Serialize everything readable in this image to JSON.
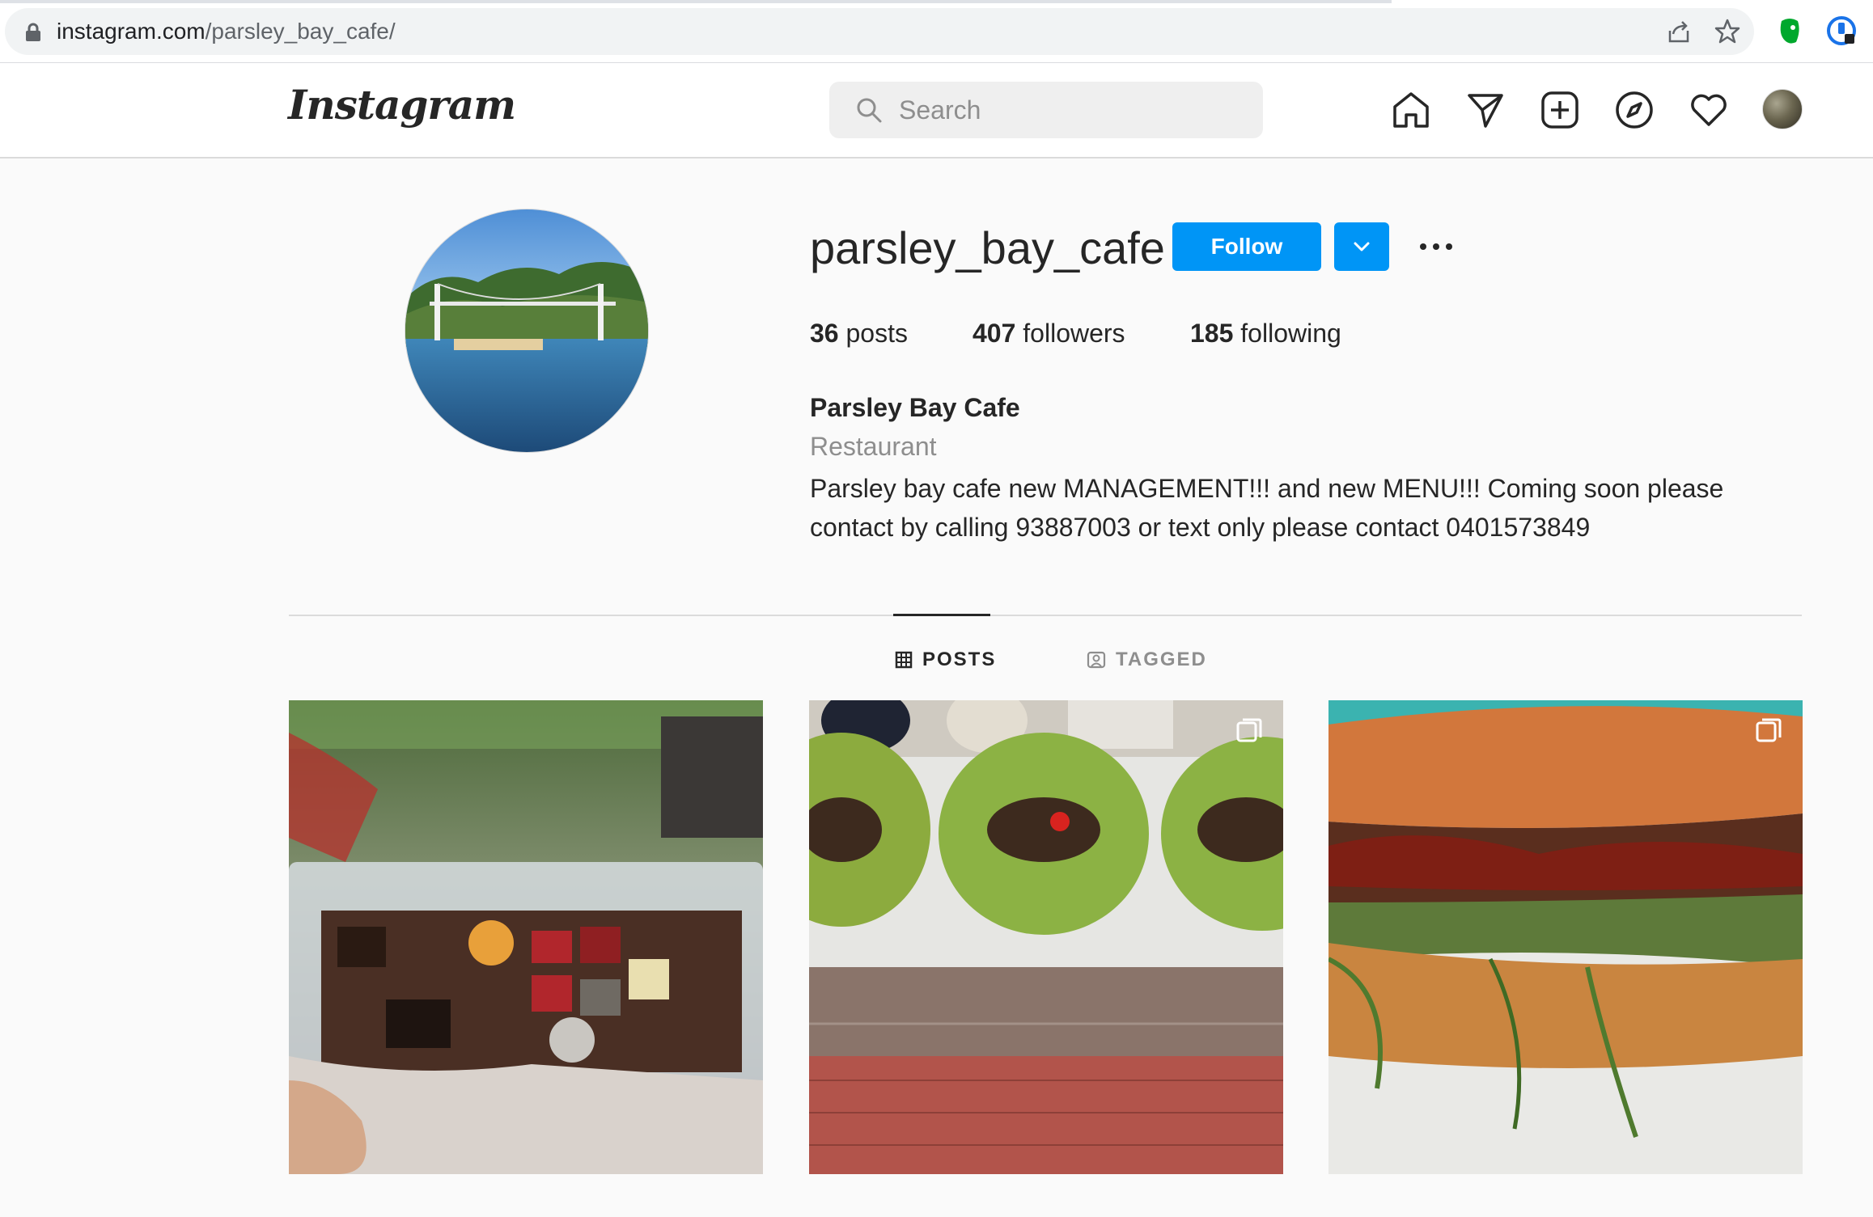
{
  "browser": {
    "url_domain": "instagram.com",
    "url_path": "/parsley_bay_cafe/"
  },
  "header": {
    "logo": "Instagram",
    "search_placeholder": "Search"
  },
  "profile": {
    "username": "parsley_bay_cafe",
    "follow_label": "Follow",
    "stats": {
      "posts_count": "36",
      "posts_label": "posts",
      "followers_count": "407",
      "followers_label": "followers",
      "following_count": "185",
      "following_label": "following"
    },
    "display_name": "Parsley Bay Cafe",
    "category": "Restaurant",
    "bio": "Parsley bay cafe new MANAGEMENT!!! and new MENU!!! Coming soon please contact by calling 93887003 or text only please contact 0401573849"
  },
  "tabs": [
    {
      "label": "POSTS",
      "active": true,
      "icon": "grid-icon"
    },
    {
      "label": "TAGGED",
      "active": false,
      "icon": "tagged-icon"
    }
  ],
  "posts": [
    {
      "subject": "chocolates-gift-box",
      "multi": false
    },
    {
      "subject": "wraps-with-eggplant-and-rocket",
      "multi": true
    },
    {
      "subject": "steak-sandwich",
      "multi": true
    }
  ],
  "colors": {
    "follow_blue": "#0095f6",
    "background": "#fafafa",
    "text": "#262626",
    "muted": "#8e8e8e"
  }
}
